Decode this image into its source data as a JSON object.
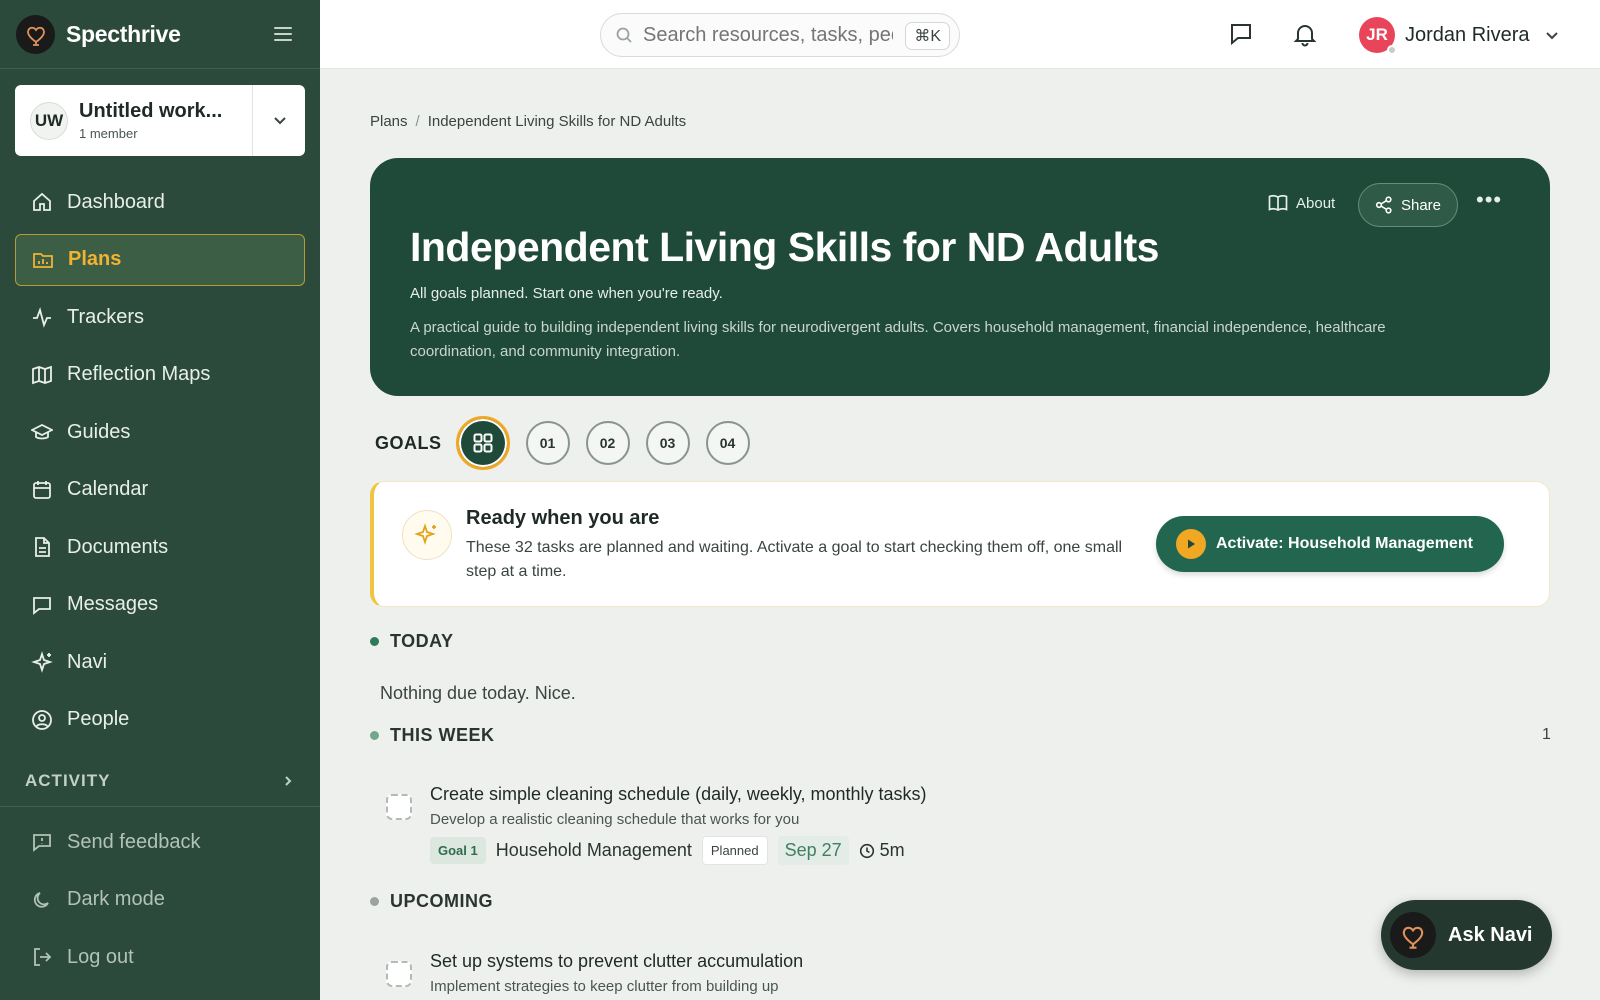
{
  "brand": {
    "name": "Specthrive"
  },
  "workspace": {
    "initials": "UW",
    "name": "Untitled work...",
    "members": "1 member"
  },
  "nav": [
    {
      "label": "Dashboard",
      "icon": "home-icon"
    },
    {
      "label": "Plans",
      "icon": "folder-chart-icon",
      "active": true
    },
    {
      "label": "Trackers",
      "icon": "activity-icon"
    },
    {
      "label": "Reflection Maps",
      "icon": "map-icon"
    },
    {
      "label": "Guides",
      "icon": "graduation-cap-icon"
    },
    {
      "label": "Calendar",
      "icon": "calendar-icon"
    },
    {
      "label": "Documents",
      "icon": "document-icon"
    },
    {
      "label": "Messages",
      "icon": "message-icon"
    },
    {
      "label": "Navi",
      "icon": "sparkle-icon"
    },
    {
      "label": "People",
      "icon": "user-circle-icon"
    }
  ],
  "activity_label": "ACTIVITY",
  "bottom_nav": [
    {
      "label": "Send feedback",
      "icon": "feedback-icon"
    },
    {
      "label": "Dark mode",
      "icon": "moon-icon"
    },
    {
      "label": "Log out",
      "icon": "logout-icon"
    }
  ],
  "topbar": {
    "search_placeholder": "Search resources, tasks, people...",
    "search_shortcut": "⌘K",
    "user_initials": "JR",
    "user_name": "Jordan Rivera"
  },
  "breadcrumb": {
    "root": "Plans",
    "current": "Independent Living Skills for ND Adults"
  },
  "hero": {
    "title": "Independent Living Skills for ND Adults",
    "status": "All goals planned. Start one when you're ready.",
    "description": "A practical guide to building independent living skills for neurodivergent adults. Covers household management, financial independence, healthcare coordination, and community integration.",
    "about_label": "About",
    "share_label": "Share"
  },
  "goals": {
    "label": "GOALS",
    "items": [
      "01",
      "02",
      "03",
      "04"
    ]
  },
  "ready": {
    "title": "Ready when you are",
    "text": "These 32 tasks are planned and waiting. Activate a goal to start checking them off, one small step at a time.",
    "button_label": "Activate: Household Management"
  },
  "sections": {
    "today": {
      "label": "TODAY",
      "empty": "Nothing due today. Nice."
    },
    "this_week": {
      "label": "THIS WEEK",
      "count": "1"
    },
    "upcoming": {
      "label": "UPCOMING"
    }
  },
  "tasks": {
    "this_week": [
      {
        "title": "Create simple cleaning schedule (daily, weekly, monthly tasks)",
        "description": "Develop a realistic cleaning schedule that works for you",
        "goal_badge": "Goal 1",
        "goal_name": "Household Management",
        "status": "Planned",
        "date": "Sep 27",
        "duration": "5m"
      }
    ],
    "upcoming": [
      {
        "title": "Set up systems to prevent clutter accumulation",
        "description": "Implement strategies to keep clutter from building up"
      }
    ]
  },
  "ask_navi": {
    "label": "Ask Navi"
  },
  "colors": {
    "sidebar": "#2b4a3b",
    "hero": "#1f4a39",
    "accent": "#f0a723",
    "primary_button": "#236650",
    "avatar": "#e8455a"
  }
}
